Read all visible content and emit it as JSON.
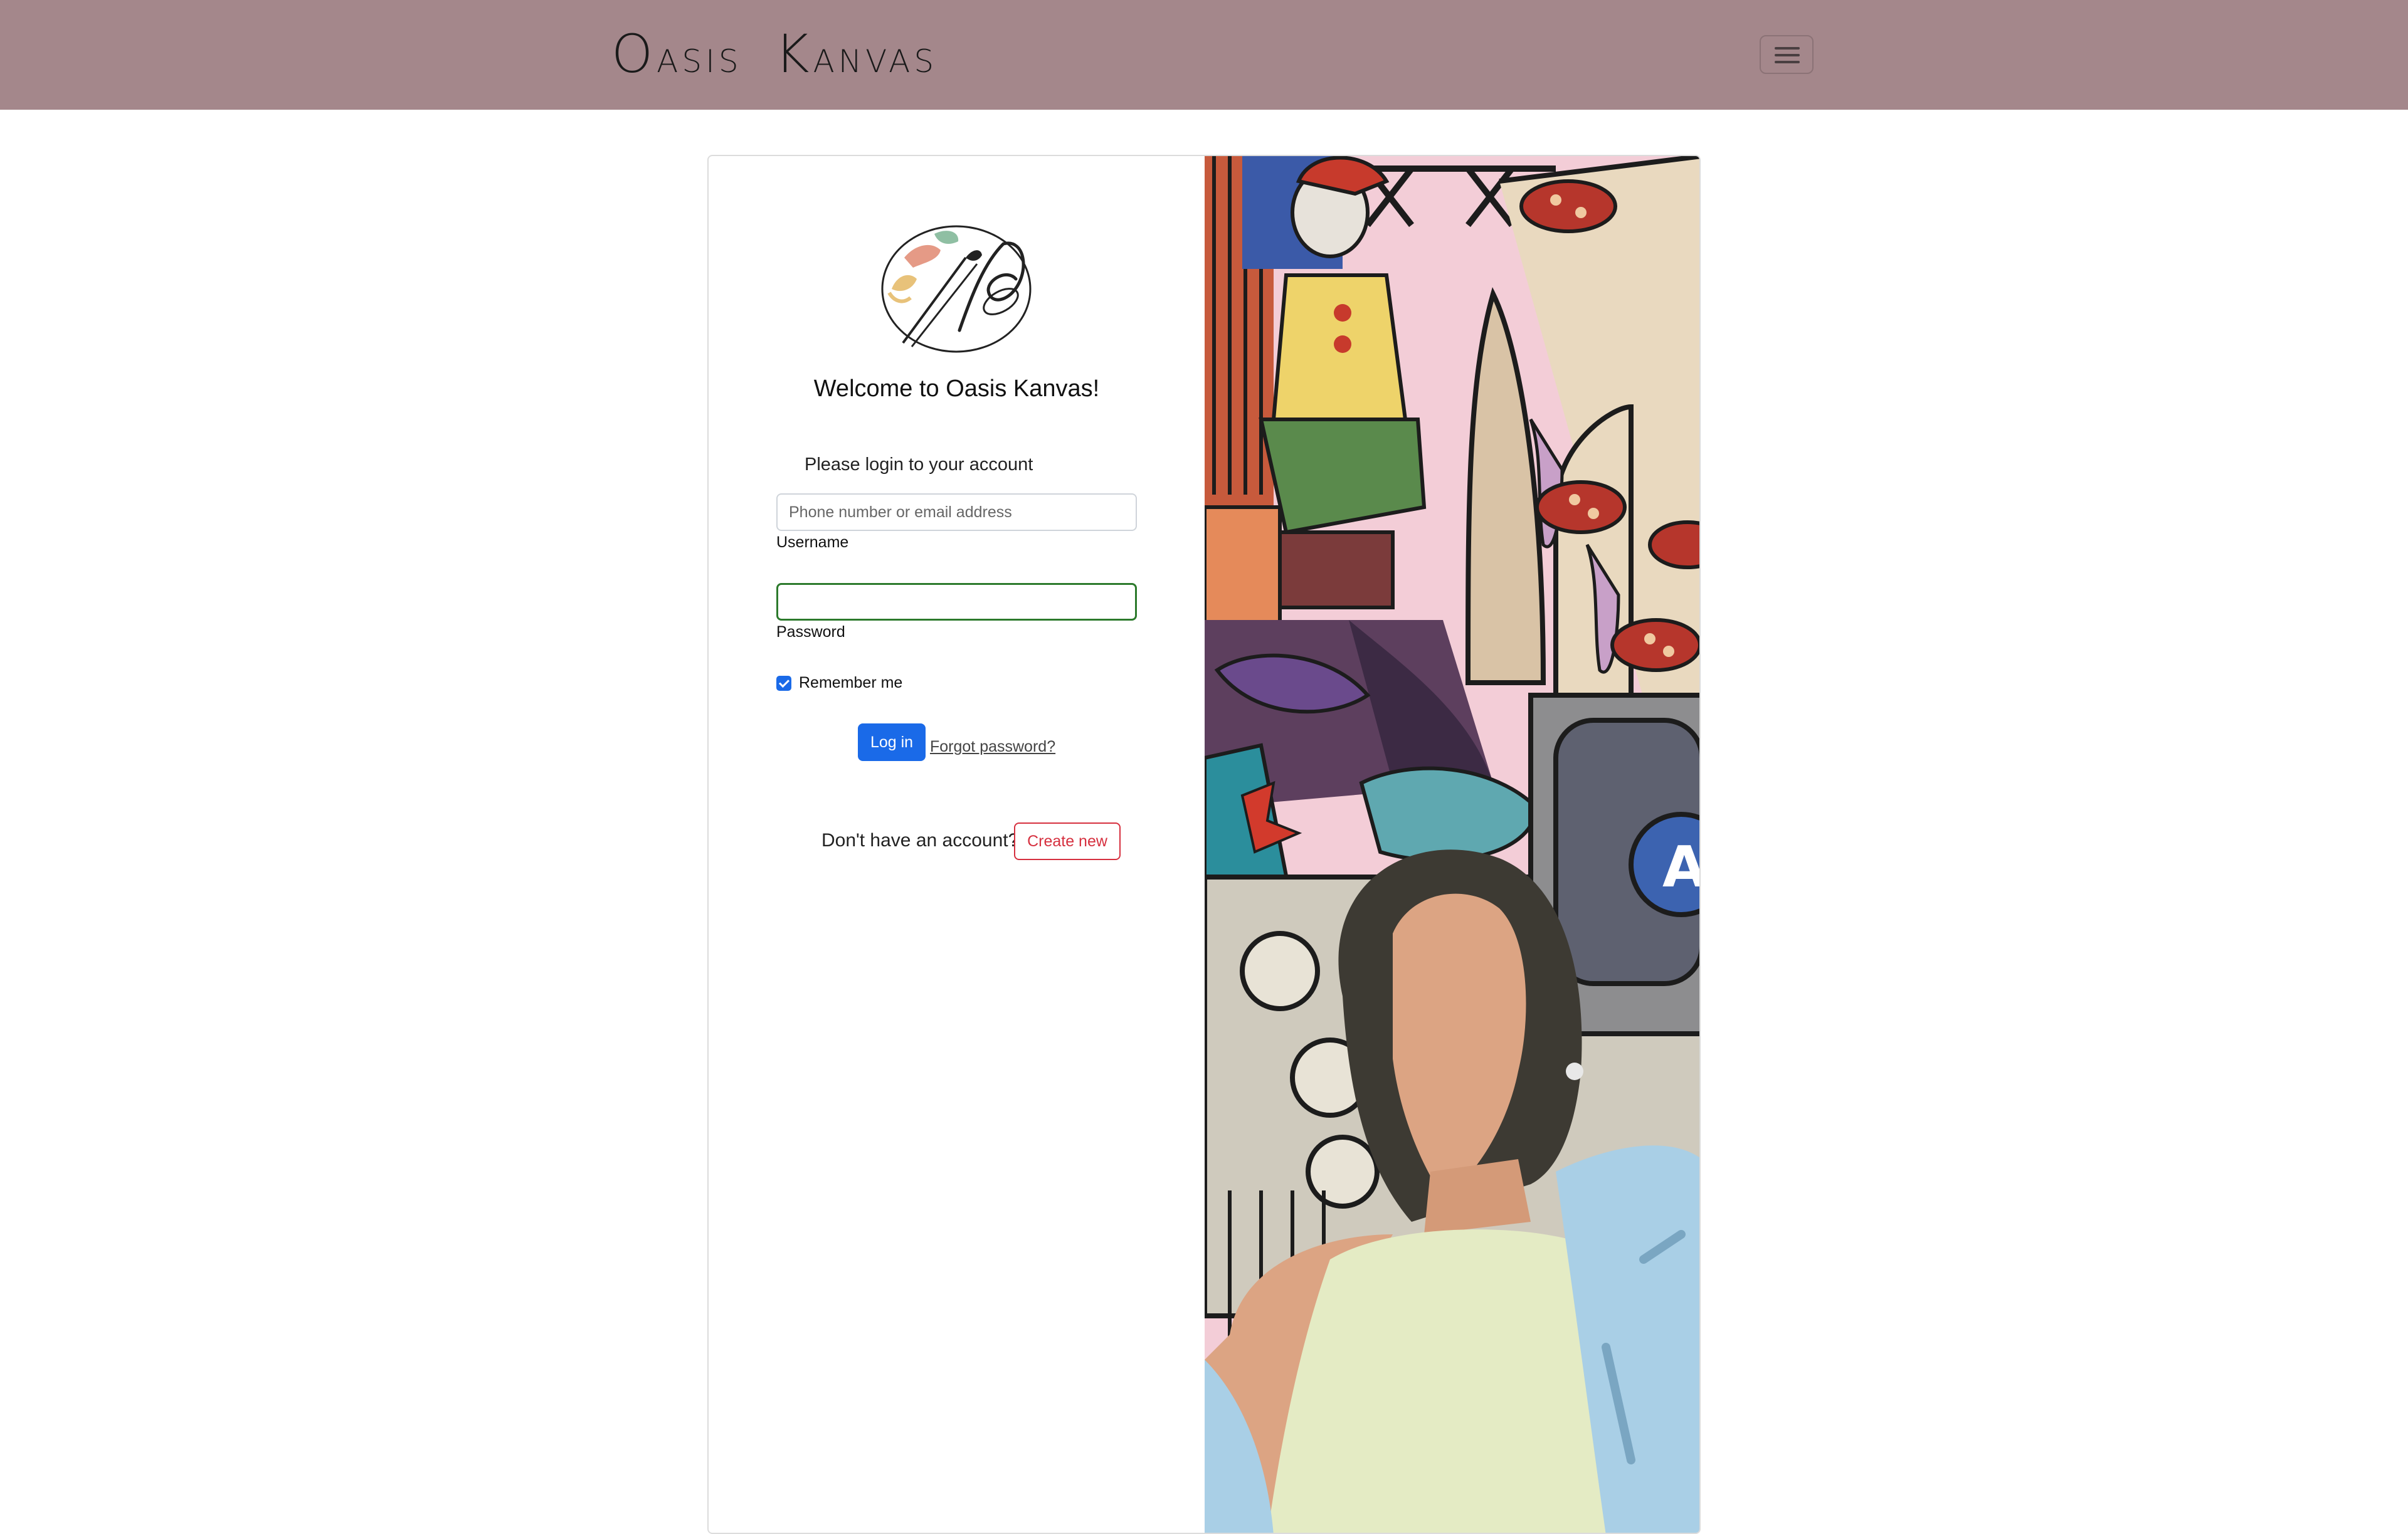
{
  "navbar": {
    "brand_first_initial": "O",
    "brand_first_rest": "ASIS",
    "brand_second_initial": "K",
    "brand_second_rest": "ANVAS",
    "menu_icon": "hamburger-icon",
    "background_color": "#a4878b"
  },
  "login": {
    "logo_icon": "palette-brush-logo",
    "welcome": "Welcome to Oasis Kanvas!",
    "subtitle": "Please login to your account",
    "username_placeholder": "Phone number or email address",
    "username_value": "",
    "username_label": "Username",
    "password_value": "",
    "password_label": "Password",
    "remember_label": "Remember me",
    "remember_checked": true,
    "login_button": "Log in",
    "forgot_link": "Forgot password?",
    "no_account_text": "Don't have an account?",
    "create_button": "Create new"
  },
  "illustration": {
    "description_icon": "collage-illustration",
    "colors": {
      "primary_blue": "#1a6ae8",
      "danger_red": "#d6303f",
      "valid_green": "#2c7a2c"
    }
  }
}
